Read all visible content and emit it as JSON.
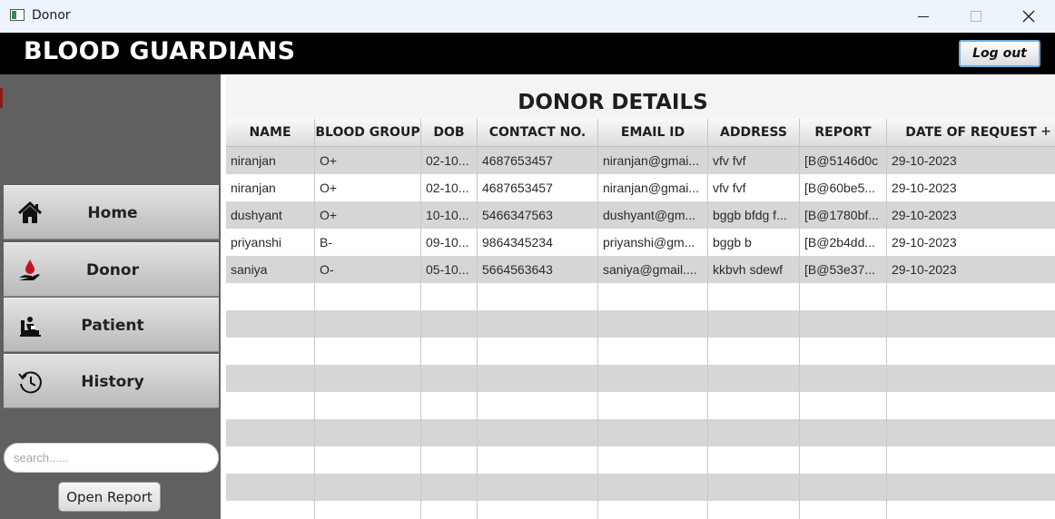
{
  "window": {
    "title": "Donor",
    "controls": [
      "minimize",
      "maximize",
      "close"
    ]
  },
  "header": {
    "brand": "BLOOD GUARDIANS",
    "logout_label": "Log out"
  },
  "sidebar": {
    "items": [
      {
        "label": "Home",
        "icon": "home-icon"
      },
      {
        "label": "Donor",
        "icon": "blood-donation-icon"
      },
      {
        "label": "Patient",
        "icon": "patient-icon"
      },
      {
        "label": "History",
        "icon": "history-icon"
      }
    ],
    "search": {
      "placeholder": "search......",
      "value": ""
    },
    "open_report_label": "Open Report"
  },
  "main": {
    "title": "DONOR DETAILS",
    "columns": [
      "NAME",
      "BLOOD GROUP",
      "DOB",
      "CONTACT NO.",
      "EMAIL ID",
      "ADDRESS",
      "REPORT",
      "DATE OF REQUEST"
    ],
    "rows": [
      [
        "niranjan",
        "O+",
        "02-10...",
        "4687653457",
        "niranjan@gmai...",
        "vfv fvf",
        "[B@5146d0c",
        "29-10-2023"
      ],
      [
        "niranjan",
        "O+",
        "02-10...",
        "4687653457",
        "niranjan@gmai...",
        "vfv fvf",
        "[B@60be5...",
        "29-10-2023"
      ],
      [
        "dushyant",
        "O+",
        "10-10...",
        "5466347563",
        "dushyant@gm...",
        "bggb bfdg f...",
        "[B@1780bf...",
        "29-10-2023"
      ],
      [
        "priyanshi",
        "B-",
        "09-10...",
        "9864345234",
        "priyanshi@gm...",
        "bggb b",
        "[B@2b4dd...",
        "29-10-2023"
      ],
      [
        "saniya",
        "O-",
        "05-10...",
        "5664563643",
        "saniya@gmail....",
        "kkbvh sdewf",
        "[B@53e37...",
        "29-10-2023"
      ]
    ],
    "empty_rows": 9
  },
  "colors": {
    "header_bg": "#000000",
    "sidebar_bg": "#606060",
    "accent": "#c0141e",
    "row_stripe": "#d6d6d6"
  }
}
